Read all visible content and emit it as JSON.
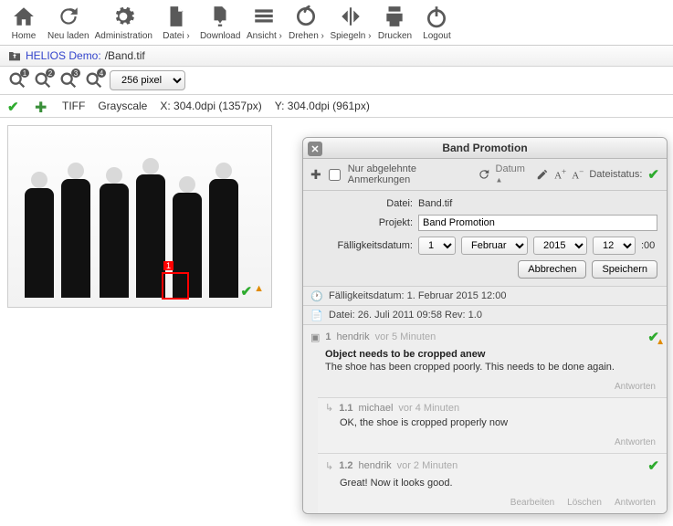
{
  "toolbar": {
    "home": "Home",
    "reload": "Neu laden",
    "admin": "Administration",
    "file": "Datei ›",
    "download": "Download",
    "view": "Ansicht ›",
    "rotate": "Drehen ›",
    "mirror": "Spiegeln ›",
    "print": "Drucken",
    "logout": "Logout"
  },
  "path": {
    "root": "HELIOS Demo:",
    "file": "/Band.tif"
  },
  "zoom": {
    "select": "256 pixel"
  },
  "info": {
    "format": "TIFF",
    "colorspace": "Grayscale",
    "x": "X:  304.0dpi (1357px)",
    "y": "Y:  304.0dpi (961px)"
  },
  "panel": {
    "title": "Band Promotion",
    "opt_rejected": "Nur abgelehnte Anmerkungen",
    "date_sort": "Datum",
    "filestatus_label": "Dateistatus:",
    "form": {
      "file_label": "Datei:",
      "file_value": "Band.tif",
      "project_label": "Projekt:",
      "project_value": "Band Promotion",
      "due_label": "Fälligkeitsdatum:",
      "day": "1",
      "month": "Februar",
      "year": "2015",
      "hour": "12",
      "min_suffix": ":00",
      "cancel": "Abbrechen",
      "save": "Speichern"
    },
    "meta_due": "Fälligkeitsdatum: 1. Februar 2015 12:00",
    "meta_file": "Datei: 26. Juli 2011 09:58  Rev: 1.0",
    "c1": {
      "num": "1",
      "user": "hendrik",
      "time": "vor 5 Minuten",
      "title": "Object needs to be cropped anew",
      "body": "The shoe has been cropped poorly. This needs to be done again.",
      "reply": "Antworten"
    },
    "r11": {
      "num": "1.1",
      "user": "michael",
      "time": "vor 4 Minuten",
      "body": "OK, the shoe is cropped properly now",
      "reply": "Antworten"
    },
    "r12": {
      "num": "1.2",
      "user": "hendrik",
      "time": "vor 2 Minuten",
      "body": "Great! Now it looks good.",
      "edit": "Bearbeiten",
      "delete": "Löschen",
      "reply": "Antworten"
    }
  }
}
